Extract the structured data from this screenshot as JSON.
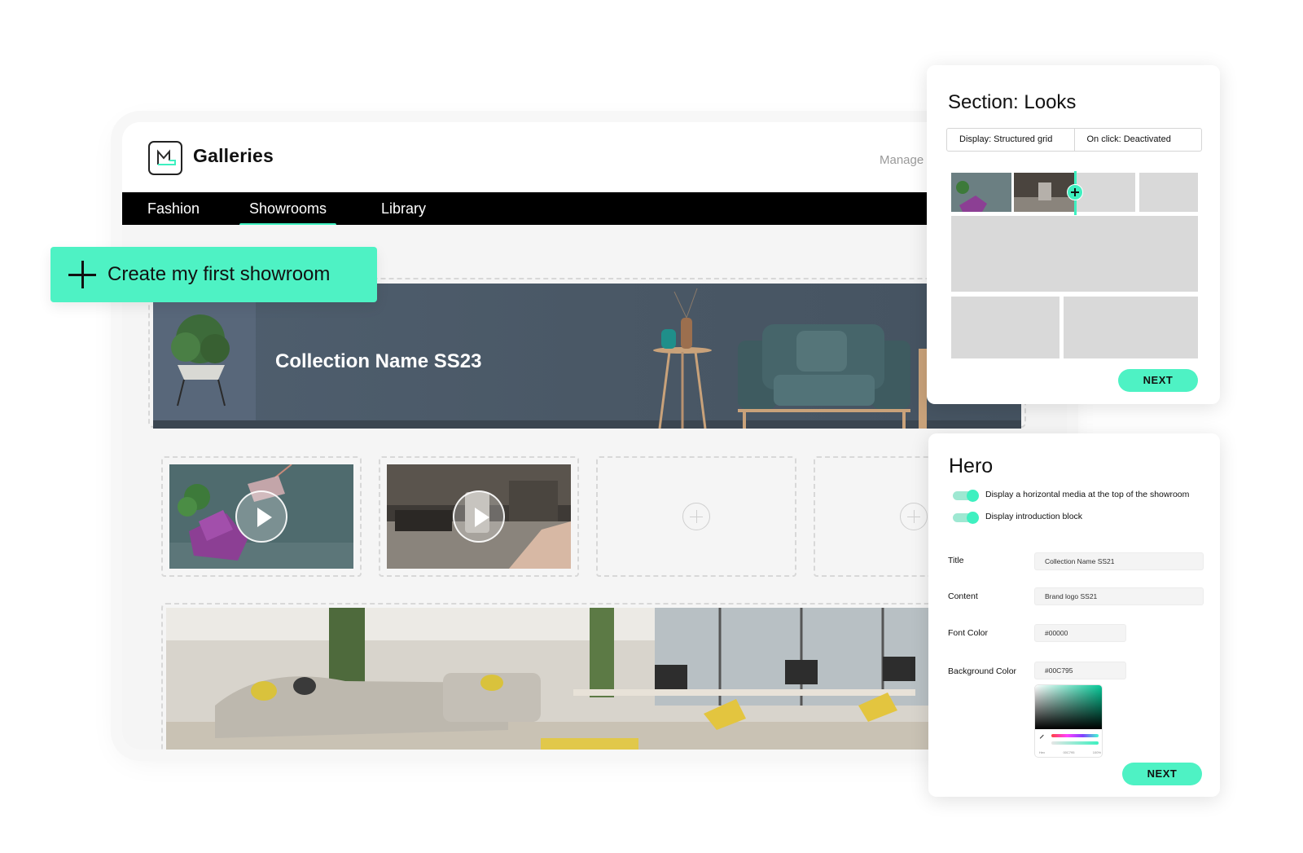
{
  "app": {
    "title": "Galleries",
    "header_hint": "Manage y",
    "nav": [
      "Fashion",
      "Showrooms",
      "Library"
    ],
    "active_nav": "Showrooms"
  },
  "create_button": {
    "label": "Create my first showroom"
  },
  "hero_banner": {
    "title": "Collection Name SS23"
  },
  "media_slots": [
    {
      "type": "video"
    },
    {
      "type": "video"
    },
    {
      "type": "empty"
    },
    {
      "type": "empty"
    }
  ],
  "looks_panel": {
    "title": "Section: Looks",
    "display_option": "Display: Structured grid",
    "onclick_option": "On click: Deactivated",
    "next_label": "NEXT"
  },
  "hero_panel": {
    "title": "Hero",
    "toggles": [
      {
        "label": "Display a horizontal media at the top of the showroom",
        "on": true
      },
      {
        "label": "Display introduction block",
        "on": true
      }
    ],
    "fields": {
      "title": {
        "label": "Title",
        "value": "Collection Name SS21"
      },
      "content": {
        "label": "Content",
        "value": "Brand logo SS21"
      },
      "font_color": {
        "label": "Font Color",
        "value": "#00000"
      },
      "background_color": {
        "label": "Background Color",
        "value": "#00C795"
      }
    },
    "picker_readout": [
      "Hex",
      "00C795",
      "100%"
    ],
    "next_label": "NEXT"
  },
  "colors": {
    "accent": "#4EF2C4",
    "nav_background": "#000000",
    "hero_banner": "#4F5F6F"
  }
}
